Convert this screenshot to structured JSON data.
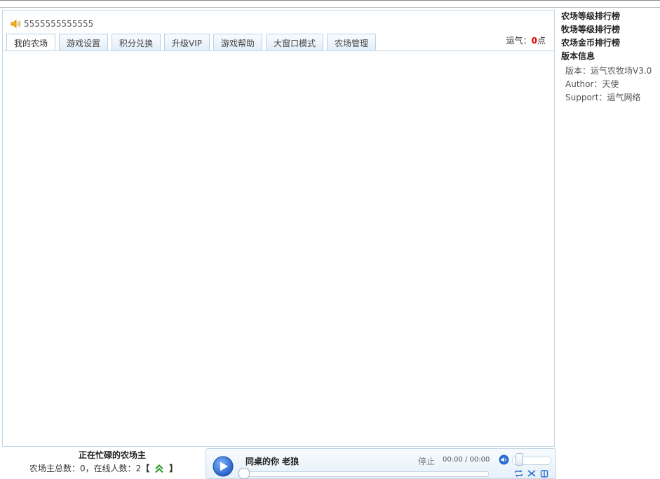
{
  "marquee": {
    "text": "5555555555555",
    "icon": "speaker-icon"
  },
  "tabs": [
    {
      "label": "我的农场",
      "active": true
    },
    {
      "label": "游戏设置"
    },
    {
      "label": "积分兑换"
    },
    {
      "label": "升级VIP"
    },
    {
      "label": "游戏帮助"
    },
    {
      "label": "大窗口模式"
    },
    {
      "label": "农场管理"
    }
  ],
  "luck": {
    "label": "运气：",
    "value": "0",
    "unit": "点"
  },
  "sidebar": {
    "links": [
      "农场等级排行榜",
      "牧场等级排行榜",
      "农场金币排行榜"
    ],
    "version_heading": "版本信息",
    "version_rows": [
      "版本：运气农牧场V3.0",
      "Author：天使",
      "Support：运气网络"
    ]
  },
  "bottom": {
    "busy_title": "正在忙碌的农场主",
    "stats_text": "农场主总数：0，在线人数：2",
    "bracket_open": "【",
    "bracket_close": "】",
    "scroll_icon": "double-chevron-up-icon"
  },
  "player": {
    "song": "同桌的你  老狼",
    "stop_label": "停止",
    "time": "00:00 / 00:00",
    "volume_level": 0.1,
    "progress": 0.0,
    "icons": [
      "play-icon",
      "volume-icon",
      "repeat-icon",
      "shuffle-icon",
      "playlist-icon"
    ]
  },
  "colors": {
    "accent_border": "#bcd6e8",
    "luck_value": "#e00000",
    "play_blue": "#2a6fd0"
  }
}
